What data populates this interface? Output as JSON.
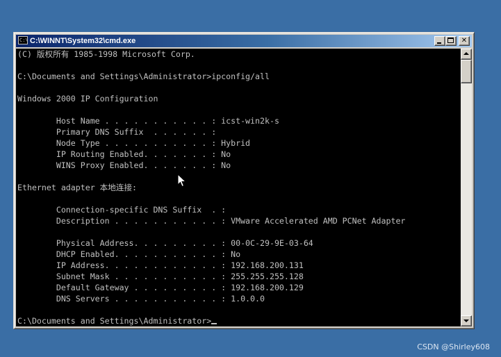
{
  "window": {
    "title": "C:\\WINNT\\System32\\cmd.exe",
    "icon": "console-app-icon",
    "icon_glyph": "C:\\",
    "buttons": {
      "minimize": "minimize-icon",
      "maximize": "maximize-icon",
      "close": "close-icon",
      "close_glyph": "✕"
    }
  },
  "console": {
    "lines": [
      "(C) 版权所有 1985-1998 Microsoft Corp.",
      "",
      "C:\\Documents and Settings\\Administrator>ipconfig/all",
      "",
      "Windows 2000 IP Configuration",
      "",
      "        Host Name . . . . . . . . . . . : icst-win2k-s",
      "        Primary DNS Suffix  . . . . . . :",
      "        Node Type . . . . . . . . . . . : Hybrid",
      "        IP Routing Enabled. . . . . . . : No",
      "        WINS Proxy Enabled. . . . . . . : No",
      "",
      "Ethernet adapter 本地连接:",
      "",
      "        Connection-specific DNS Suffix  . :",
      "        Description . . . . . . . . . . . : VMware Accelerated AMD PCNet Adapter",
      "",
      "        Physical Address. . . . . . . . . : 00-0C-29-9E-03-64",
      "        DHCP Enabled. . . . . . . . . . . : No",
      "        IP Address. . . . . . . . . . . . : 192.168.200.131",
      "        Subnet Mask . . . . . . . . . . . : 255.255.255.128",
      "        Default Gateway . . . . . . . . . : 192.168.200.129",
      "        DNS Servers . . . . . . . . . . . : 1.0.0.0",
      "",
      "C:\\Documents and Settings\\Administrator>"
    ],
    "colors": {
      "background": "#000000",
      "text": "#c0c0c0"
    }
  },
  "desktop": {
    "background": "#3a6ea5",
    "watermark": "CSDN @Shirley608"
  }
}
